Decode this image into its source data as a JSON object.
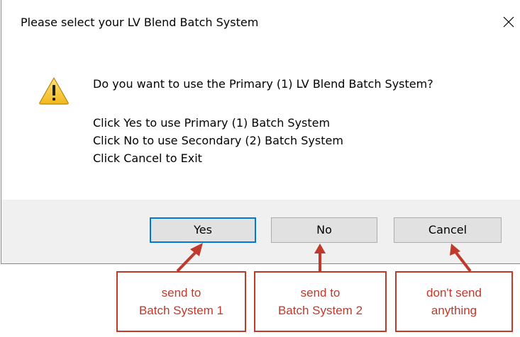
{
  "dialog": {
    "title": "Please select your LV Blend Batch System",
    "close_glyph": "✕",
    "icon": "warning-icon",
    "message": {
      "question": "Do you want to use the Primary (1) LV Blend Batch System?",
      "line1": "Click Yes to use Primary (1) Batch System",
      "line2": "Click No to use Secondary (2) Batch System",
      "line3": "Click Cancel to Exit"
    },
    "buttons": {
      "yes": "Yes",
      "no": "No",
      "cancel": "Cancel"
    }
  },
  "annotations": {
    "yes": {
      "line1": "send to",
      "line2": "Batch System 1"
    },
    "no": {
      "line1": "send to",
      "line2": "Batch System 2"
    },
    "cancel": {
      "line1": "don't send",
      "line2": "anything"
    },
    "color": "#c0392b"
  }
}
